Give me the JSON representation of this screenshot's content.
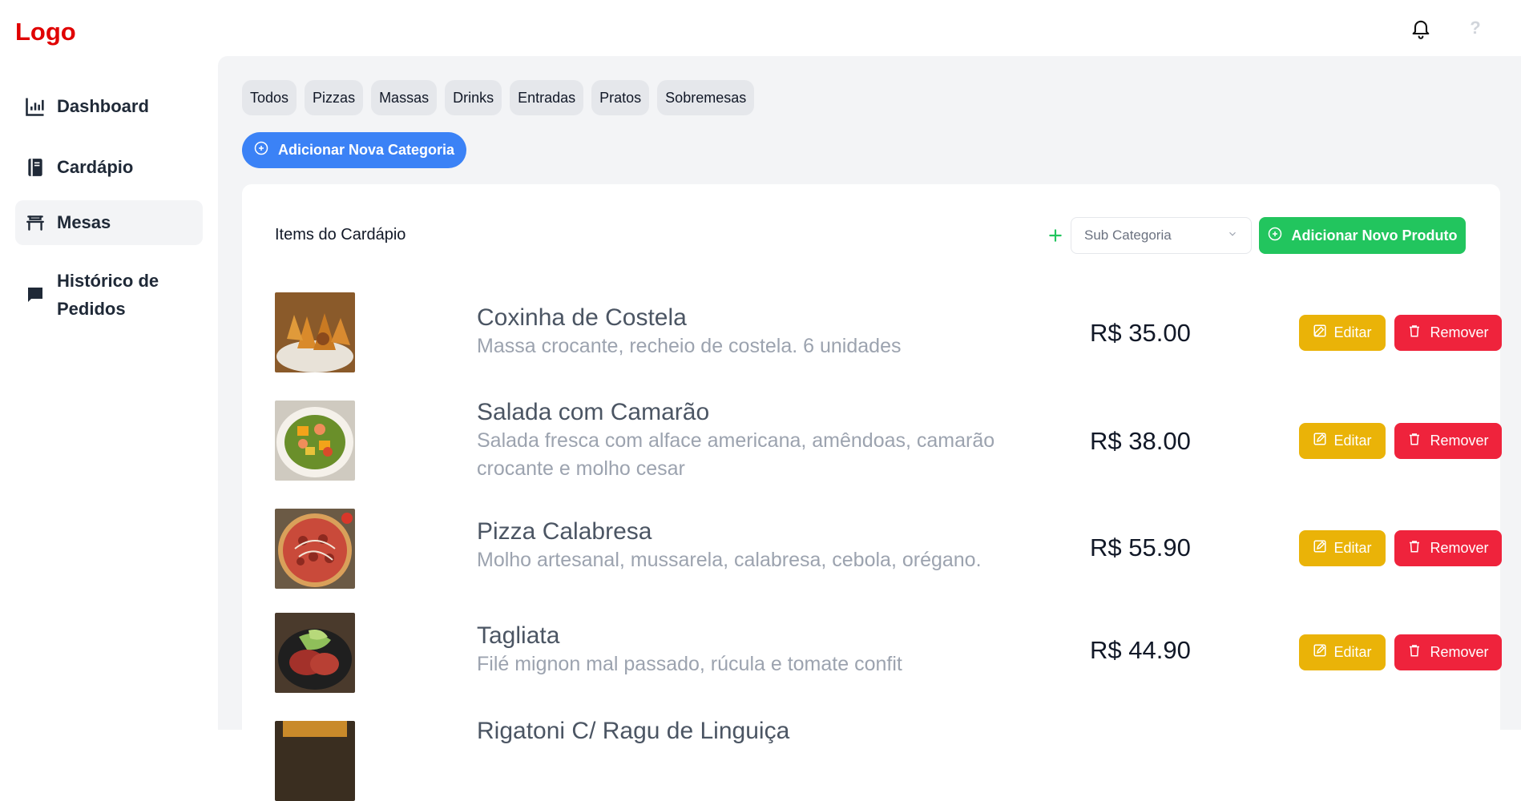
{
  "header": {
    "logo": "Logo",
    "icons": [
      "bell-icon",
      "help-icon"
    ]
  },
  "sidebar": {
    "items": [
      {
        "label": "Dashboard",
        "icon": "bar-chart-icon",
        "active": false
      },
      {
        "label": "Cardápio",
        "icon": "book-icon",
        "active": false
      },
      {
        "label": "Mesas",
        "icon": "table-icon",
        "active": true
      },
      {
        "label": "Histórico de Pedidos",
        "icon": "chat-icon",
        "active": false
      }
    ]
  },
  "main": {
    "category_tabs": [
      "Todos",
      "Pizzas",
      "Massas",
      "Drinks",
      "Entradas",
      "Pratos",
      "Sobremesas"
    ],
    "add_category_label": "Adicionar Nova Categoria",
    "card": {
      "title": "Items do Cardápio",
      "subcategory_placeholder": "Sub Categoria",
      "add_product_label": "Adicionar Novo Produto",
      "edit_label": "Editar",
      "remove_label": "Remover",
      "items": [
        {
          "name": "Coxinha de Costela",
          "description": "Massa crocante, recheio de costela. 6 unidades",
          "price": "R$ 35.00",
          "image": "coxinha-photo"
        },
        {
          "name": "Salada com Camarão",
          "description": "Salada fresca com alface americana, amêndoas, camarão crocante e molho cesar",
          "price": "R$ 38.00",
          "image": "salad-photo"
        },
        {
          "name": "Pizza Calabresa",
          "description": "Molho artesanal, mussarela, calabresa, cebola, orégano.",
          "price": "R$ 55.90",
          "image": "pizza-photo"
        },
        {
          "name": "Tagliata",
          "description": "Filé mignon mal passado, rúcula e tomate confit",
          "price": "R$ 44.90",
          "image": "steak-photo"
        },
        {
          "name": "Rigatoni C/ Ragu de Linguiça",
          "description": "",
          "price": "",
          "image": "pasta-photo"
        }
      ]
    }
  },
  "colors": {
    "logo": "#e00000",
    "primary_blue": "#3b82f6",
    "add_green": "#22c55e",
    "edit_yellow": "#eab308",
    "remove_red": "#ef233c",
    "main_bg": "#f3f4f6"
  }
}
